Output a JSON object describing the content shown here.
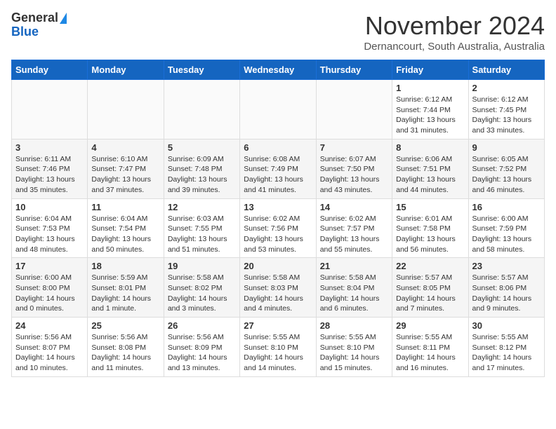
{
  "logo": {
    "general": "General",
    "blue": "Blue"
  },
  "header": {
    "month": "November 2024",
    "location": "Dernancourt, South Australia, Australia"
  },
  "weekdays": [
    "Sunday",
    "Monday",
    "Tuesday",
    "Wednesday",
    "Thursday",
    "Friday",
    "Saturday"
  ],
  "weeks": [
    [
      {
        "day": "",
        "info": ""
      },
      {
        "day": "",
        "info": ""
      },
      {
        "day": "",
        "info": ""
      },
      {
        "day": "",
        "info": ""
      },
      {
        "day": "",
        "info": ""
      },
      {
        "day": "1",
        "info": "Sunrise: 6:12 AM\nSunset: 7:44 PM\nDaylight: 13 hours\nand 31 minutes."
      },
      {
        "day": "2",
        "info": "Sunrise: 6:12 AM\nSunset: 7:45 PM\nDaylight: 13 hours\nand 33 minutes."
      }
    ],
    [
      {
        "day": "3",
        "info": "Sunrise: 6:11 AM\nSunset: 7:46 PM\nDaylight: 13 hours\nand 35 minutes."
      },
      {
        "day": "4",
        "info": "Sunrise: 6:10 AM\nSunset: 7:47 PM\nDaylight: 13 hours\nand 37 minutes."
      },
      {
        "day": "5",
        "info": "Sunrise: 6:09 AM\nSunset: 7:48 PM\nDaylight: 13 hours\nand 39 minutes."
      },
      {
        "day": "6",
        "info": "Sunrise: 6:08 AM\nSunset: 7:49 PM\nDaylight: 13 hours\nand 41 minutes."
      },
      {
        "day": "7",
        "info": "Sunrise: 6:07 AM\nSunset: 7:50 PM\nDaylight: 13 hours\nand 43 minutes."
      },
      {
        "day": "8",
        "info": "Sunrise: 6:06 AM\nSunset: 7:51 PM\nDaylight: 13 hours\nand 44 minutes."
      },
      {
        "day": "9",
        "info": "Sunrise: 6:05 AM\nSunset: 7:52 PM\nDaylight: 13 hours\nand 46 minutes."
      }
    ],
    [
      {
        "day": "10",
        "info": "Sunrise: 6:04 AM\nSunset: 7:53 PM\nDaylight: 13 hours\nand 48 minutes."
      },
      {
        "day": "11",
        "info": "Sunrise: 6:04 AM\nSunset: 7:54 PM\nDaylight: 13 hours\nand 50 minutes."
      },
      {
        "day": "12",
        "info": "Sunrise: 6:03 AM\nSunset: 7:55 PM\nDaylight: 13 hours\nand 51 minutes."
      },
      {
        "day": "13",
        "info": "Sunrise: 6:02 AM\nSunset: 7:56 PM\nDaylight: 13 hours\nand 53 minutes."
      },
      {
        "day": "14",
        "info": "Sunrise: 6:02 AM\nSunset: 7:57 PM\nDaylight: 13 hours\nand 55 minutes."
      },
      {
        "day": "15",
        "info": "Sunrise: 6:01 AM\nSunset: 7:58 PM\nDaylight: 13 hours\nand 56 minutes."
      },
      {
        "day": "16",
        "info": "Sunrise: 6:00 AM\nSunset: 7:59 PM\nDaylight: 13 hours\nand 58 minutes."
      }
    ],
    [
      {
        "day": "17",
        "info": "Sunrise: 6:00 AM\nSunset: 8:00 PM\nDaylight: 14 hours\nand 0 minutes."
      },
      {
        "day": "18",
        "info": "Sunrise: 5:59 AM\nSunset: 8:01 PM\nDaylight: 14 hours\nand 1 minute."
      },
      {
        "day": "19",
        "info": "Sunrise: 5:58 AM\nSunset: 8:02 PM\nDaylight: 14 hours\nand 3 minutes."
      },
      {
        "day": "20",
        "info": "Sunrise: 5:58 AM\nSunset: 8:03 PM\nDaylight: 14 hours\nand 4 minutes."
      },
      {
        "day": "21",
        "info": "Sunrise: 5:58 AM\nSunset: 8:04 PM\nDaylight: 14 hours\nand 6 minutes."
      },
      {
        "day": "22",
        "info": "Sunrise: 5:57 AM\nSunset: 8:05 PM\nDaylight: 14 hours\nand 7 minutes."
      },
      {
        "day": "23",
        "info": "Sunrise: 5:57 AM\nSunset: 8:06 PM\nDaylight: 14 hours\nand 9 minutes."
      }
    ],
    [
      {
        "day": "24",
        "info": "Sunrise: 5:56 AM\nSunset: 8:07 PM\nDaylight: 14 hours\nand 10 minutes."
      },
      {
        "day": "25",
        "info": "Sunrise: 5:56 AM\nSunset: 8:08 PM\nDaylight: 14 hours\nand 11 minutes."
      },
      {
        "day": "26",
        "info": "Sunrise: 5:56 AM\nSunset: 8:09 PM\nDaylight: 14 hours\nand 13 minutes."
      },
      {
        "day": "27",
        "info": "Sunrise: 5:55 AM\nSunset: 8:10 PM\nDaylight: 14 hours\nand 14 minutes."
      },
      {
        "day": "28",
        "info": "Sunrise: 5:55 AM\nSunset: 8:10 PM\nDaylight: 14 hours\nand 15 minutes."
      },
      {
        "day": "29",
        "info": "Sunrise: 5:55 AM\nSunset: 8:11 PM\nDaylight: 14 hours\nand 16 minutes."
      },
      {
        "day": "30",
        "info": "Sunrise: 5:55 AM\nSunset: 8:12 PM\nDaylight: 14 hours\nand 17 minutes."
      }
    ]
  ]
}
